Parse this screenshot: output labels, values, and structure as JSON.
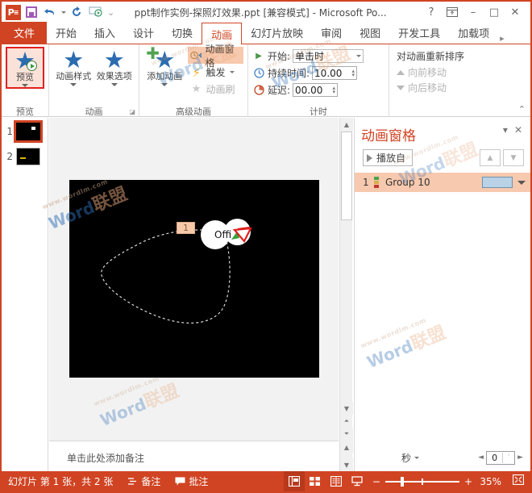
{
  "window": {
    "title": "ppt制作实例-探照灯效果.ppt [兼容模式] - Microsoft Po...",
    "app_icon": "powerpoint-icon",
    "quick_access": [
      {
        "name": "save-icon",
        "label": "保存"
      },
      {
        "name": "undo-icon",
        "label": "撤消"
      },
      {
        "name": "redo-icon",
        "label": "重复"
      },
      {
        "name": "slideshow-icon",
        "label": "从头开始"
      },
      {
        "name": "customize-qat-icon",
        "label": "自定义快速访问工具栏"
      }
    ],
    "controls": [
      {
        "name": "help-button",
        "glyph": "?"
      },
      {
        "name": "ribbon-display-options-button",
        "glyph": "⌶"
      },
      {
        "name": "minimize-button",
        "glyph": "–"
      },
      {
        "name": "maximize-button",
        "glyph": "□"
      },
      {
        "name": "close-button",
        "glyph": "✕"
      }
    ]
  },
  "tabs": {
    "file": "文件",
    "items": [
      {
        "label": "开始",
        "active": false
      },
      {
        "label": "插入",
        "active": false
      },
      {
        "label": "设计",
        "active": false
      },
      {
        "label": "切换",
        "active": false
      },
      {
        "label": "动画",
        "active": true
      },
      {
        "label": "幻灯片放映",
        "active": false
      },
      {
        "label": "审阅",
        "active": false
      },
      {
        "label": "视图",
        "active": false
      },
      {
        "label": "开发工具",
        "active": false
      },
      {
        "label": "加载项",
        "active": false
      }
    ],
    "overflow": "▸"
  },
  "ribbon": {
    "groups": [
      {
        "title": "预览"
      },
      {
        "title": "动画"
      },
      {
        "title": "高级动画"
      },
      {
        "title": "计时"
      }
    ],
    "preview": {
      "label": "预览"
    },
    "animation": {
      "styles_label": "动画样式",
      "effect_options_label": "效果选项"
    },
    "advanced": {
      "add_animation_label": "添加动画",
      "animation_pane_label": "动画窗格",
      "trigger_label": "触发",
      "animation_painter_label": "动画刷"
    },
    "timing": {
      "start_label": "开始:",
      "start_value": "单击时",
      "duration_label": "持续时间:",
      "duration_value": "10.00",
      "delay_label": "延迟:",
      "delay_value": "00.00",
      "reorder_label": "对动画重新排序",
      "move_earlier_label": "向前移动",
      "move_later_label": "向后移动"
    },
    "collapse_label": "⌃"
  },
  "slides": {
    "thumbnails": [
      {
        "number": "1",
        "selected": true
      },
      {
        "number": "2",
        "selected": false
      }
    ]
  },
  "slide_canvas": {
    "sequence_tag": "1",
    "object_text": "Offi",
    "object_name": "Group 10"
  },
  "notes": {
    "placeholder": "单击此处添加备注"
  },
  "animation_pane": {
    "title": "动画窗格",
    "collapse_label": "▾",
    "close_label": "✕",
    "play_button": "播放自",
    "move_up_label": "▲",
    "move_down_label": "▼",
    "rows": [
      {
        "index": "1",
        "name": "Group 10"
      }
    ],
    "seconds_label": "秒",
    "scroll_value": "0"
  },
  "statusbar": {
    "slide_info": "幻灯片 第 1 张，共 2 张",
    "notes_label": "备注",
    "comments_label": "批注",
    "views": [
      {
        "name": "normal-view-button",
        "active": true
      },
      {
        "name": "slide-sorter-view-button",
        "active": false
      },
      {
        "name": "reading-view-button",
        "active": false
      },
      {
        "name": "slideshow-view-button",
        "active": false
      }
    ],
    "zoom_out": "−",
    "zoom_in": "+",
    "zoom_value": "35%",
    "fit_label": "适应窗口"
  },
  "colors": {
    "accent": "#d04423",
    "ribbon_highlight": "#f7c9ae",
    "anim_bar": "#b9d2e6",
    "star_blue": "#2b6cb0"
  },
  "watermark": {
    "text_a": "Word",
    "text_b": "联盟",
    "url": "www.wordlm.com"
  }
}
